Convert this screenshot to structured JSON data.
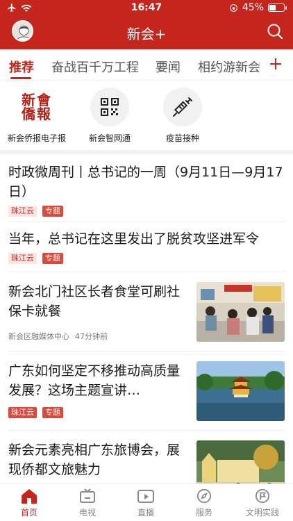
{
  "status": {
    "time": "16:47",
    "battery": "45%",
    "battery_level": 0.45
  },
  "header": {
    "title": "新会+"
  },
  "tabs": [
    {
      "label": "推荐",
      "active": true
    },
    {
      "label": "奋战百千万工程"
    },
    {
      "label": "要闻"
    },
    {
      "label": "相约游新会"
    }
  ],
  "quick_entries": [
    {
      "label": "新会侨报电子报",
      "icon": "newspaper-logo",
      "logo_text": "新會僑報"
    },
    {
      "label": "新会智网通",
      "icon": "qr-code-icon"
    },
    {
      "label": "疫苗接种",
      "icon": "syringe-icon"
    }
  ],
  "news": [
    {
      "title": "时政微周刊丨总书记的一周（9月11日—9月17日）",
      "tags": [
        "珠江云",
        "专题"
      ]
    },
    {
      "title": "当年，总书记在这里发出了脱贫攻坚进军令",
      "tags": [
        "珠江云",
        "专题"
      ]
    },
    {
      "title": "新会北门社区长者食堂可刷社保卡就餐",
      "source": "新会区融媒体中心",
      "time": "47分钟前",
      "image": "canteen-photo"
    },
    {
      "title": "广东如何坚定不移推动高质量发展？这场主题宣讲…",
      "tags": [
        "珠江云",
        "专题"
      ],
      "image": "pavilion-lake-photo"
    },
    {
      "title": "新会元素亮相广东旅博会，展现侨都文旅魅力",
      "image": "expo-booth-photo"
    }
  ],
  "bottom_nav": [
    {
      "label": "首页",
      "icon": "home-icon",
      "active": true
    },
    {
      "label": "电视",
      "icon": "tv-icon"
    },
    {
      "label": "直播",
      "icon": "live-icon"
    },
    {
      "label": "服务",
      "icon": "compass-icon"
    },
    {
      "label": "文明实践",
      "icon": "flag-icon"
    }
  ],
  "colors": {
    "brand_red": "#c4261d",
    "tag_fill": "#d94a3e",
    "tag_soft": "#fbe5e3"
  }
}
